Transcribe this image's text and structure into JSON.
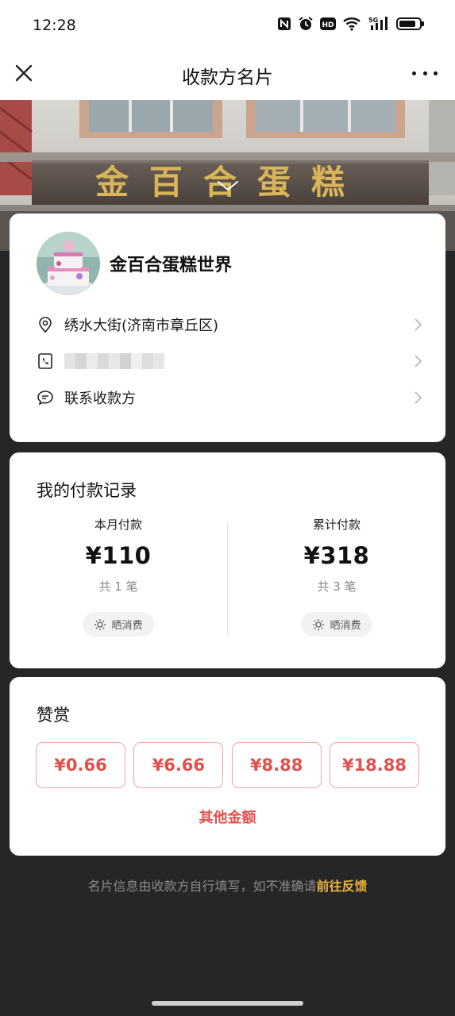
{
  "status_bar": {
    "time": "12:28",
    "icons": [
      "nfc-icon",
      "alarm-icon",
      "hd-icon",
      "wifi-icon",
      "5g-signal-icon",
      "battery-icon"
    ],
    "network_label": "5G",
    "hd_label": "HD"
  },
  "nav": {
    "title": "收款方名片",
    "close_icon": "close-icon",
    "more_icon": "more-icon"
  },
  "banner": {
    "sign_text": "金百合蛋糕"
  },
  "profile": {
    "shop_name": "金百合蛋糕世界",
    "address": "绣水大街(济南市章丘区)",
    "phone": "",
    "contact_label": "联系收款方"
  },
  "payments": {
    "title": "我的付款记录",
    "month": {
      "label": "本月付款",
      "amount": "¥110",
      "count": "共 1 笔",
      "share_label": "晒消费"
    },
    "total": {
      "label": "累计付款",
      "amount": "¥318",
      "count": "共 3 笔",
      "share_label": "晒消费"
    }
  },
  "tips": {
    "title": "赞赏",
    "options": [
      "¥0.66",
      "¥6.66",
      "¥8.88",
      "¥18.88"
    ],
    "other_label": "其他金额"
  },
  "footer": {
    "note": "名片信息由收款方自行填写，如不准确请",
    "link": "前往反馈"
  },
  "colors": {
    "accent_red": "#e0514d",
    "link_yellow": "#e9b43b",
    "background_dark": "#262626"
  }
}
